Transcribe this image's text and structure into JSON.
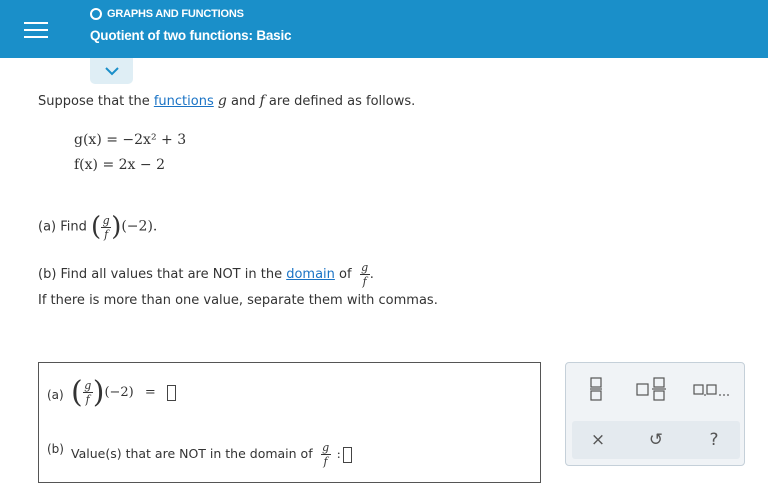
{
  "header": {
    "topic": "GRAPHS AND FUNCTIONS",
    "title": "Quotient of two functions: Basic"
  },
  "problem": {
    "intro_before": "Suppose that the ",
    "intro_link": "functions",
    "intro_g": "g",
    "intro_and": " and ",
    "intro_f": "f",
    "intro_after": " are defined as follows.",
    "g_def": "g(x) = −2x² + 3",
    "f_def": "f(x) = 2x − 2",
    "part_a_prefix": "(a) Find",
    "part_a_arg": "(−2).",
    "part_b_before": "(b) Find all values that are NOT in the ",
    "part_b_link": "domain",
    "part_b_after": " of",
    "instruction": "If there is more than one value, separate them with commas."
  },
  "answer": {
    "a_label": "(a)",
    "a_arg": "(−2)",
    "equals": "=",
    "b_label": "(b)",
    "b_text": "Value(s) that are NOT in the domain of",
    "colon": ":"
  },
  "toolbar": {
    "clear_label": "×",
    "undo_label": "↺",
    "help_label": "?",
    "list_label": "□,□,..."
  },
  "colors": {
    "header_bg": "#1a8fc9",
    "link": "#1a73c5"
  }
}
